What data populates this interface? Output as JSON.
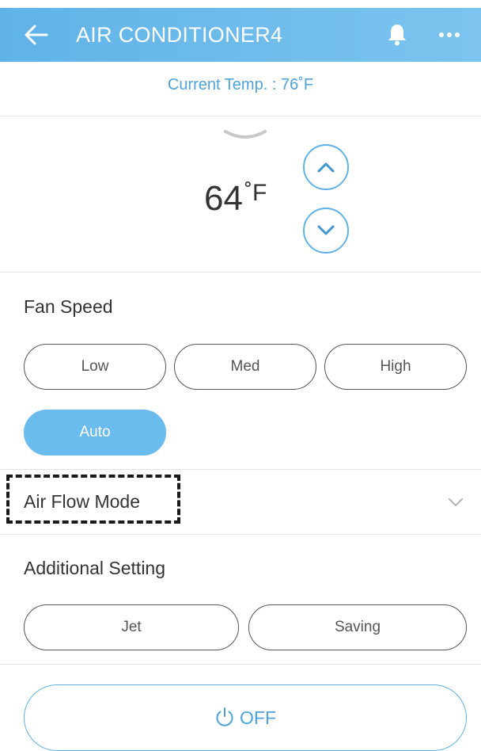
{
  "header": {
    "title": "AIR CONDITIONER4",
    "back_icon": "arrow-left-icon",
    "bell_icon": "bell-icon",
    "more_icon": "more-horizontal-icon",
    "background": "#6ab9ec"
  },
  "status": {
    "current_temp": "Current Temp. : 76˚F"
  },
  "temperature": {
    "value": "64",
    "unit": "˚F",
    "collapse_icon": "chevron-down-icon",
    "up_icon": "chevron-up-icon",
    "down_icon": "chevron-down-icon"
  },
  "fan_speed": {
    "title": "Fan Speed",
    "options": [
      "Low",
      "Med",
      "High",
      "Auto"
    ],
    "selected": "Auto"
  },
  "air_flow": {
    "title": "Air Flow Mode"
  },
  "additional": {
    "title": "Additional Setting",
    "options": [
      "Jet",
      "Saving"
    ]
  },
  "power": {
    "label": "OFF",
    "icon": "power-icon"
  },
  "colors": {
    "accent": "#5fb3e8",
    "active_pill": "#6bbcee",
    "text": "#333333"
  }
}
